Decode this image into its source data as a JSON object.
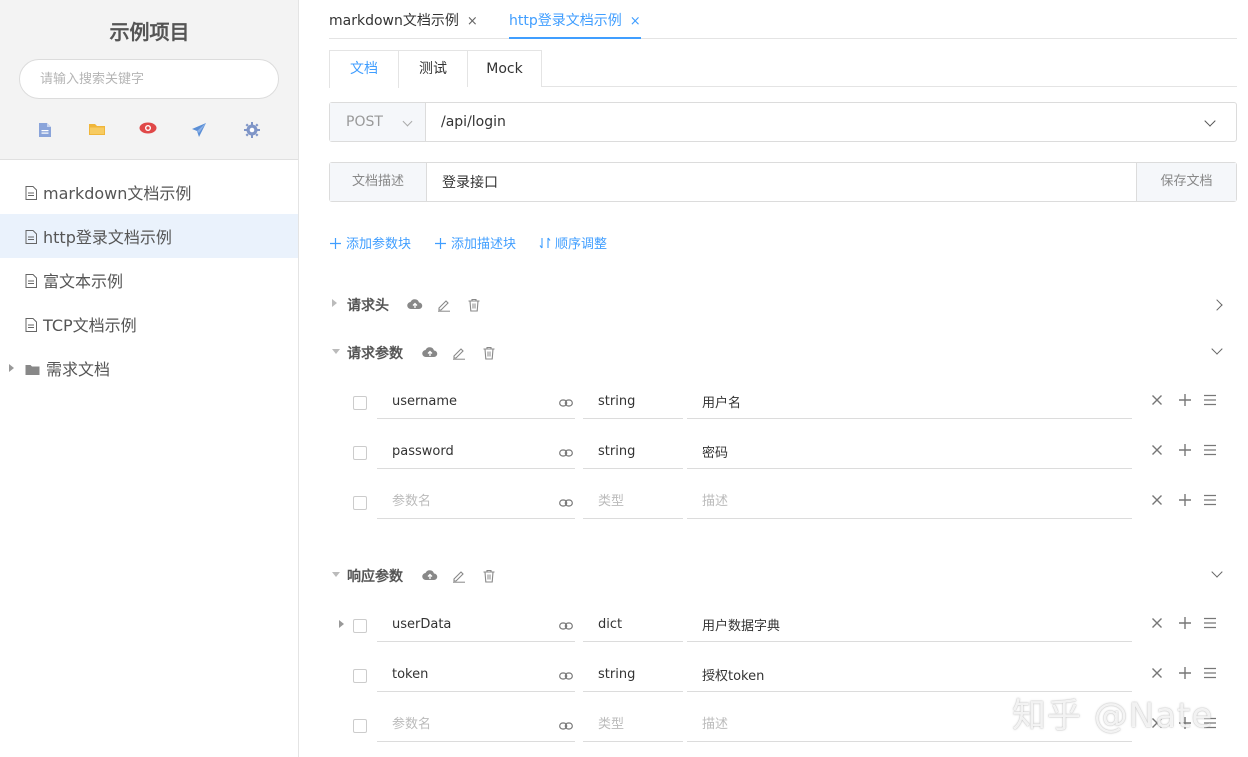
{
  "sidebar": {
    "project_title": "示例项目",
    "search_placeholder": "请输入搜索关键字",
    "tools": [
      {
        "icon": "file-icon",
        "color": "#6f8fcf"
      },
      {
        "icon": "folder-icon",
        "color": "#f0b63a"
      },
      {
        "icon": "eye-icon",
        "color": "#e04848"
      },
      {
        "icon": "send-icon",
        "color": "#5b8fd6"
      },
      {
        "icon": "gear-icon",
        "color": "#7f95c7"
      }
    ],
    "items": [
      {
        "label": "markdown文档示例",
        "icon": "document-icon"
      },
      {
        "label": "http登录文档示例",
        "icon": "document-icon",
        "active": true
      },
      {
        "label": "富文本示例",
        "icon": "document-icon"
      },
      {
        "label": "TCP文档示例",
        "icon": "document-icon"
      },
      {
        "label": "需求文档",
        "icon": "folder-icon",
        "collapsed": true
      }
    ]
  },
  "tabs": [
    {
      "label": "markdown文档示例",
      "close": "×"
    },
    {
      "label": "http登录文档示例",
      "close": "×",
      "active": true
    }
  ],
  "subtabs": [
    {
      "label": "文档",
      "active": true
    },
    {
      "label": "测试"
    },
    {
      "label": "Mock"
    }
  ],
  "request": {
    "method": "POST",
    "url": "/api/login"
  },
  "description": {
    "label": "文档描述",
    "value": "登录接口",
    "save_label": "保存文档"
  },
  "actions": {
    "add_param_block": "添加参数块",
    "add_desc_block": "添加描述块",
    "reorder": "顺序调整"
  },
  "sections": {
    "headers": {
      "title": "请求头",
      "expanded": false
    },
    "request_params": {
      "title": "请求参数",
      "expanded": true,
      "rows": [
        {
          "name": "username",
          "type": "string",
          "desc": "用户名"
        },
        {
          "name": "password",
          "type": "string",
          "desc": "密码"
        }
      ],
      "placeholder": {
        "name": "参数名",
        "type": "类型",
        "desc": "描述"
      }
    },
    "response_params": {
      "title": "响应参数",
      "expanded": true,
      "rows": [
        {
          "name": "userData",
          "type": "dict",
          "desc": "用户数据字典",
          "has_children": true
        },
        {
          "name": "token",
          "type": "string",
          "desc": "授权token"
        }
      ],
      "placeholder": {
        "name": "参数名",
        "type": "类型",
        "desc": "描述"
      }
    }
  },
  "colors": {
    "accent": "#409eff",
    "active_row": "#eaf2fc"
  },
  "watermark": "知乎 @Nate"
}
